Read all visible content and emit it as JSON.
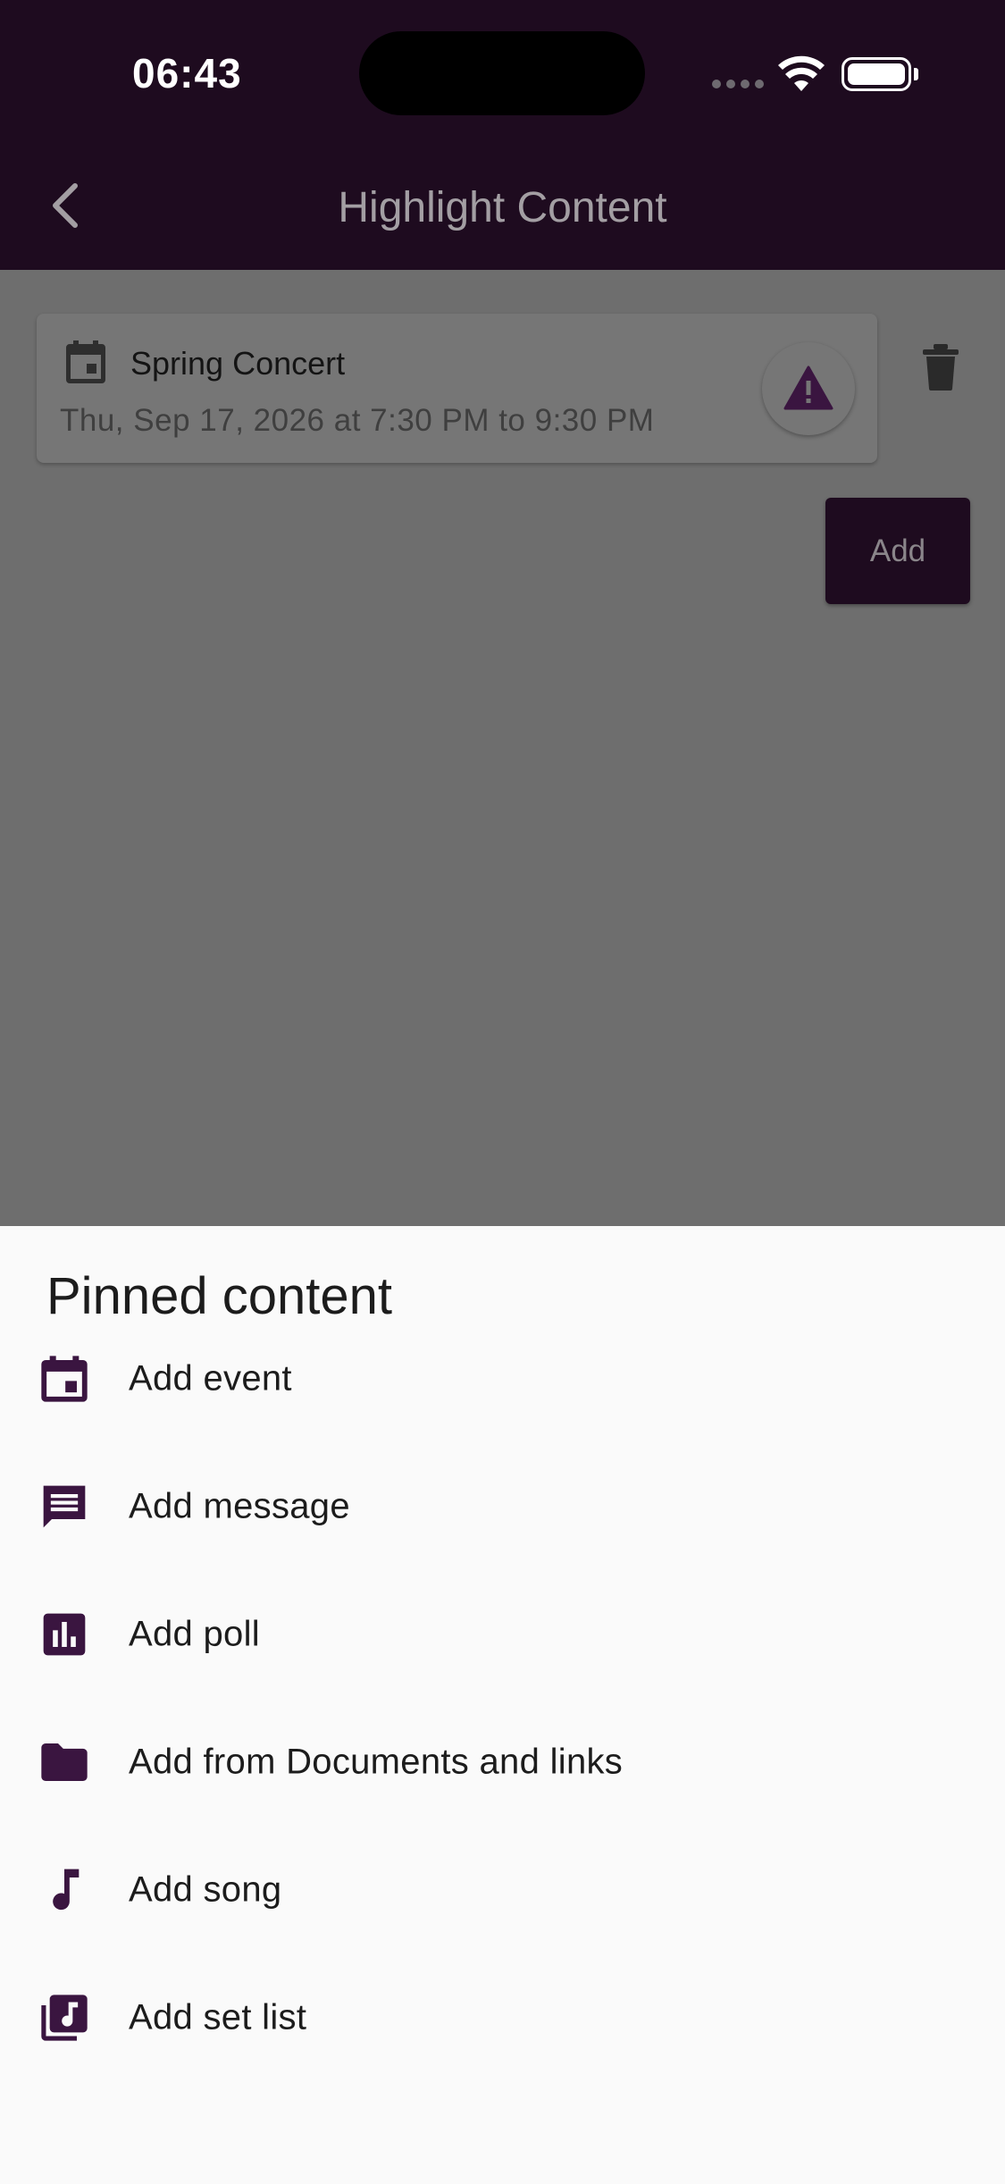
{
  "status_bar": {
    "time": "06:43"
  },
  "header": {
    "title": "Highlight Content"
  },
  "event_card": {
    "title": "Spring Concert",
    "datetime": "Thu, Sep 17, 2026 at 7:30 PM to 9:30 PM"
  },
  "actions": {
    "add_label": "Add"
  },
  "sheet": {
    "title": "Pinned content",
    "items": [
      {
        "label": "Add event",
        "icon": "calendar-icon"
      },
      {
        "label": "Add message",
        "icon": "message-icon"
      },
      {
        "label": "Add poll",
        "icon": "poll-icon"
      },
      {
        "label": "Add from Documents and links",
        "icon": "folder-icon"
      },
      {
        "label": "Add song",
        "icon": "music-note-icon"
      },
      {
        "label": "Add set list",
        "icon": "library-music-icon"
      }
    ]
  },
  "colors": {
    "brand_dark": "#1e0b1f",
    "accent_purple": "#3a1540",
    "overlay": "#6e6e6e"
  }
}
